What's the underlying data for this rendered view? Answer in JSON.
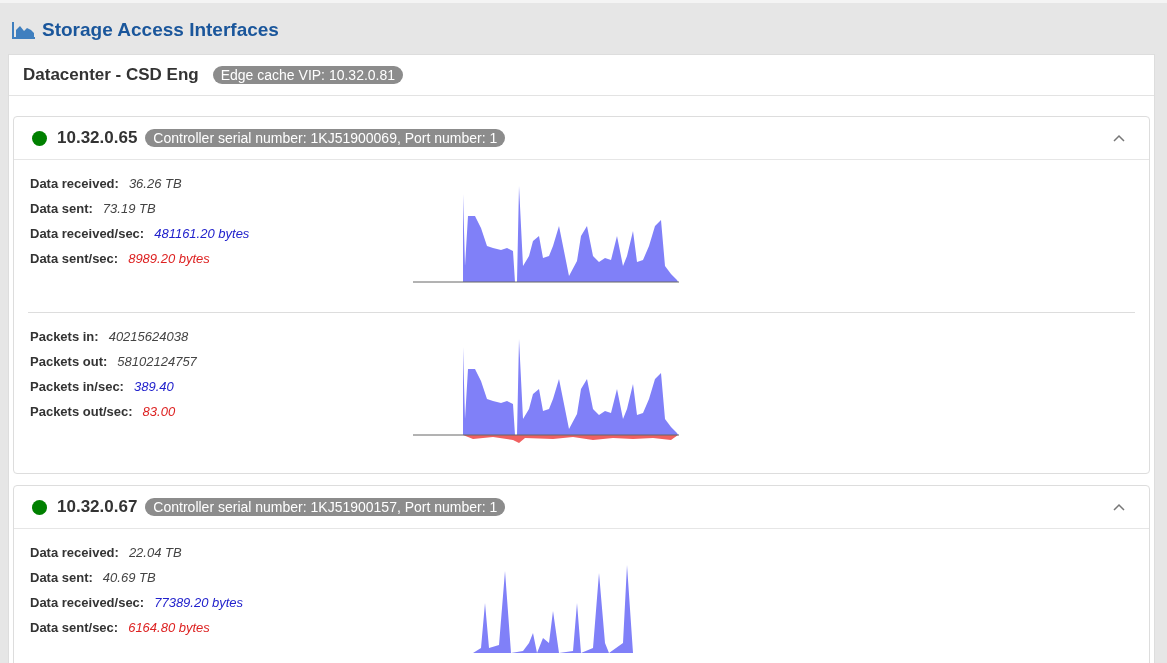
{
  "page_title": "Storage Access Interfaces",
  "panel": {
    "title": "Datacenter - CSD Eng",
    "badge": "Edge cache VIP: 10.32.0.81"
  },
  "interfaces": [
    {
      "ip": "10.32.0.65",
      "color": "#008000",
      "badge": "Controller serial number: 1KJ51900069, Port number: 1",
      "expanded": true,
      "sections": [
        {
          "kind": "in",
          "metrics": [
            {
              "label": "Data received:",
              "value": "36.26 TB",
              "kind": "total"
            },
            {
              "label": "Data sent:",
              "value": "73.19 TB",
              "kind": "total"
            },
            {
              "label": "Data received/sec:",
              "value": "481161.20 bytes",
              "kind": "in"
            },
            {
              "label": "Data sent/sec:",
              "value": "8989.20 bytes",
              "kind": "out"
            }
          ]
        },
        {
          "kind": "in_out",
          "metrics": [
            {
              "label": "Packets in:",
              "value": "40215624038",
              "kind": "total"
            },
            {
              "label": "Packets out:",
              "value": "58102124757",
              "kind": "total"
            },
            {
              "label": "Packets in/sec:",
              "value": "389.40",
              "kind": "in"
            },
            {
              "label": "Packets out/sec:",
              "value": "83.00",
              "kind": "out"
            }
          ]
        }
      ]
    },
    {
      "ip": "10.32.0.67",
      "color": "#008000",
      "badge": "Controller serial number: 1KJ51900157, Port number: 1",
      "expanded": true,
      "sections": [
        {
          "kind": "spiky",
          "metrics": [
            {
              "label": "Data received:",
              "value": "22.04 TB",
              "kind": "total"
            },
            {
              "label": "Data sent:",
              "value": "40.69 TB",
              "kind": "total"
            },
            {
              "label": "Data received/sec:",
              "value": "77389.20 bytes",
              "kind": "in"
            },
            {
              "label": "Data sent/sec:",
              "value": "6164.80 bytes",
              "kind": "out"
            }
          ]
        }
      ]
    }
  ]
}
